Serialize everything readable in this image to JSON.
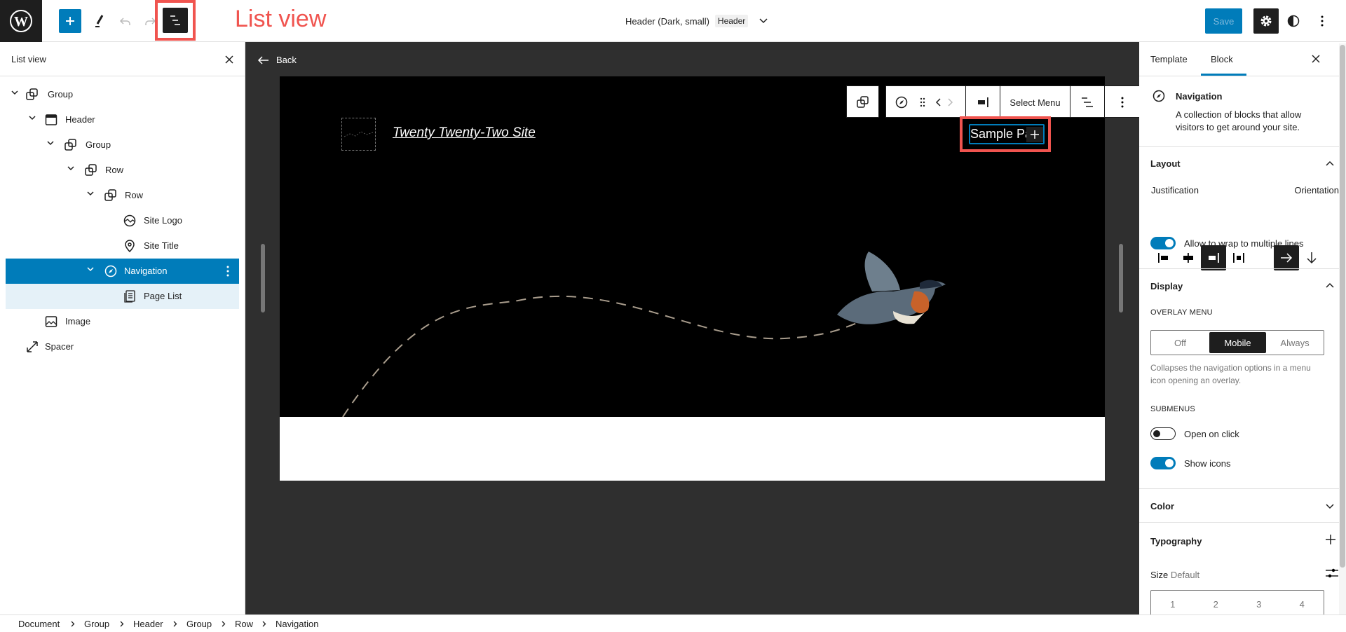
{
  "topbar": {
    "annotation": "List view",
    "document_title": "Header (Dark, small)",
    "document_badge": "Header",
    "save_label": "Save"
  },
  "list_view": {
    "title": "List view",
    "items": [
      {
        "label": "Group",
        "icon": "group-icon"
      },
      {
        "label": "Header",
        "icon": "template-part-icon"
      },
      {
        "label": "Group",
        "icon": "group-icon"
      },
      {
        "label": "Row",
        "icon": "row-icon"
      },
      {
        "label": "Row",
        "icon": "row-icon"
      },
      {
        "label": "Site Logo",
        "icon": "site-logo-icon"
      },
      {
        "label": "Site Title",
        "icon": "map-pin-icon"
      },
      {
        "label": "Navigation",
        "icon": "compass-icon",
        "selected": true
      },
      {
        "label": "Page List",
        "icon": "page-list-icon"
      },
      {
        "label": "Image",
        "icon": "image-icon"
      },
      {
        "label": "Spacer",
        "icon": "spacer-icon"
      }
    ]
  },
  "canvas": {
    "back_label": "Back",
    "site_title": "Twenty Twenty-Two Site",
    "nav_link": "Sample Pa",
    "toolbar_select_menu": "Select Menu"
  },
  "sidebar": {
    "tabs": [
      "Template",
      "Block"
    ],
    "active_tab": "Block",
    "block_title": "Navigation",
    "block_description": "A collection of blocks that allow visitors to get around your site.",
    "layout": {
      "title": "Layout",
      "justification_label": "Justification",
      "orientation_label": "Orientation",
      "wrap_label": "Allow to wrap to multiple lines",
      "wrap_on": true
    },
    "display": {
      "title": "Display",
      "overlay_label": "Overlay menu",
      "overlay_options": [
        "Off",
        "Mobile",
        "Always"
      ],
      "overlay_selected": "Mobile",
      "overlay_help": "Collapses the navigation options in a menu icon opening an overlay.",
      "submenus_label": "Submenus",
      "open_on_click_label": "Open on click",
      "open_on_click": false,
      "show_icons_label": "Show icons",
      "show_icons": true
    },
    "color_title": "Color",
    "typography": {
      "title": "Typography",
      "size_label": "Size",
      "size_value": "Default",
      "size_options": [
        "1",
        "2",
        "3",
        "4"
      ]
    }
  },
  "breadcrumb": [
    "Document",
    "Group",
    "Header",
    "Group",
    "Row",
    "Navigation"
  ],
  "colors": {
    "accent": "#007cba",
    "annotation": "#f0544f",
    "dark": "#1e1e1e",
    "canvas_bg": "#2f2f2f"
  }
}
